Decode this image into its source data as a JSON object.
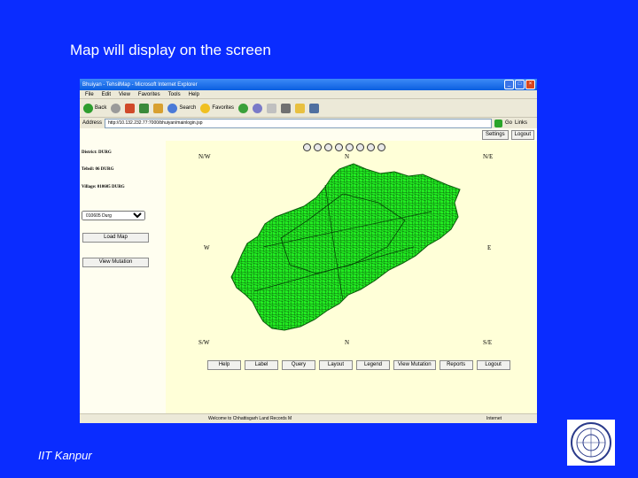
{
  "slide": {
    "title": "Map will display on the screen",
    "footer": "IIT Kanpur"
  },
  "browser": {
    "window_title": "Bhuiyan - TehsilMap - Microsoft Internet Explorer",
    "menu": [
      "File",
      "Edit",
      "View",
      "Favorites",
      "Tools",
      "Help"
    ],
    "toolbar": {
      "back": "Back",
      "search": "Search",
      "favorites": "Favorites"
    },
    "address_label": "Address",
    "address_value": "http://10.132.232.77:7000/bhuiyan/mainlogin.jsp",
    "go": "Go",
    "links": "Links",
    "status_text": "Welcome to Chhattisgarh Land Records M",
    "zone": "Internet"
  },
  "page": {
    "settings": "Settings",
    "logout": "Logout",
    "district": "District: DURG",
    "tehsil": "Tehsil: 06 DURG",
    "village": "Village: 010605 DURG",
    "village_select": "010605 Durg",
    "load_map": "Load Map",
    "view_mutation": "View Mutation",
    "compass": {
      "nw": "N/W",
      "n": "N",
      "ne": "N/E",
      "w": "W",
      "e": "E",
      "sw": "S/W",
      "s": "N",
      "se": "S/E"
    },
    "bottom_buttons": [
      "Help",
      "Label",
      "Query",
      "Layout",
      "Legend",
      "View Mutation",
      "Reports",
      "Logout"
    ]
  },
  "colors": {
    "slide_bg": "#0a2cff",
    "map_fill": "#22ee22",
    "map_bg": "#ffffd8"
  }
}
